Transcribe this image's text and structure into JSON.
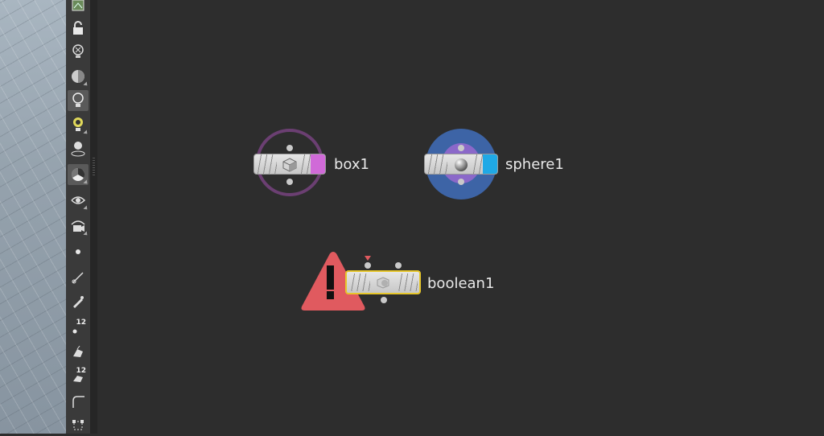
{
  "viewport": {
    "label": "scene-viewport"
  },
  "toolbar": {
    "tools": [
      {
        "name": "display-options-icon"
      },
      {
        "name": "lock-icon"
      },
      {
        "name": "close-light-icon"
      },
      {
        "name": "shading-icon"
      },
      {
        "name": "light-bulb-icon"
      },
      {
        "name": "light-add-icon"
      },
      {
        "name": "light-target-icon"
      },
      {
        "name": "radiation-icon"
      },
      {
        "name": "visibility-icon"
      },
      {
        "name": "camera-visibility-icon"
      },
      {
        "name": "point-icon"
      },
      {
        "name": "edge-icon"
      },
      {
        "name": "pen-icon"
      },
      {
        "name": "point-number-icon",
        "badge": "12"
      },
      {
        "name": "prim-icon"
      },
      {
        "name": "prim-number-icon",
        "badge": "12"
      },
      {
        "name": "curve-icon"
      },
      {
        "name": "transform-icon"
      }
    ]
  },
  "network": {
    "nodes": [
      {
        "id": "box1",
        "label": "box1",
        "flag_color": "#d06ad8",
        "ring_color": "#6b3f72"
      },
      {
        "id": "sphere1",
        "label": "sphere1",
        "flag_color": "#1fa9e6",
        "ring_color": "#3d64a6",
        "inner_ring_color": "#8b68c9"
      },
      {
        "id": "boolean1",
        "label": "boolean1",
        "selected_outline": "#e6c62a",
        "error_color": "#e05a5f",
        "error_glyph": "!"
      }
    ]
  }
}
